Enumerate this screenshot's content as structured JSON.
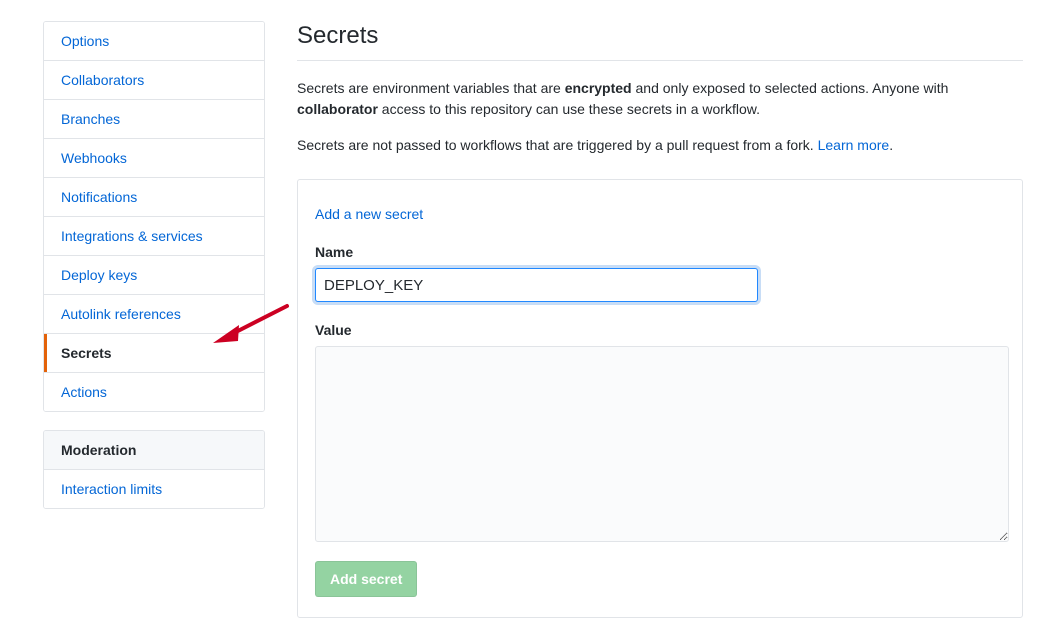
{
  "sidebar": {
    "groups": [
      {
        "name": "repository-settings-nav",
        "header": null,
        "items": [
          {
            "label": "Options",
            "selected": false
          },
          {
            "label": "Collaborators",
            "selected": false
          },
          {
            "label": "Branches",
            "selected": false
          },
          {
            "label": "Webhooks",
            "selected": false
          },
          {
            "label": "Notifications",
            "selected": false
          },
          {
            "label": "Integrations & services",
            "selected": false
          },
          {
            "label": "Deploy keys",
            "selected": false
          },
          {
            "label": "Autolink references",
            "selected": false
          },
          {
            "label": "Secrets",
            "selected": true
          },
          {
            "label": "Actions",
            "selected": false
          }
        ]
      },
      {
        "name": "moderation-nav",
        "header": "Moderation",
        "items": [
          {
            "label": "Interaction limits",
            "selected": false
          }
        ]
      }
    ]
  },
  "main": {
    "title": "Secrets",
    "paragraph1": {
      "part1": "Secrets are environment variables that are ",
      "bold1": "encrypted",
      "part2": " and only exposed to selected actions. Anyone with ",
      "bold2": "collaborator",
      "part3": " access to this repository can use these secrets in a workflow."
    },
    "paragraph2": {
      "part1": "Secrets are not passed to workflows that are triggered by a pull request from a fork. ",
      "link": "Learn more",
      "part2": "."
    },
    "form": {
      "add_link": "Add a new secret",
      "name_label": "Name",
      "name_value": "DEPLOY_KEY",
      "name_placeholder": "",
      "value_label": "Value",
      "value_value": "",
      "value_placeholder": "",
      "submit_label": "Add secret"
    }
  },
  "annotation": {
    "arrow_color": "#cc0022",
    "points_to": "Secrets"
  },
  "colors": {
    "link": "#0366d6",
    "text": "#24292e",
    "border": "#e1e4e8",
    "selected_marker": "#e36209",
    "header_bg": "#f6f8fa",
    "button_bg": "#94d3a2",
    "focus_border": "#2188ff",
    "arrow": "#cc0022"
  }
}
